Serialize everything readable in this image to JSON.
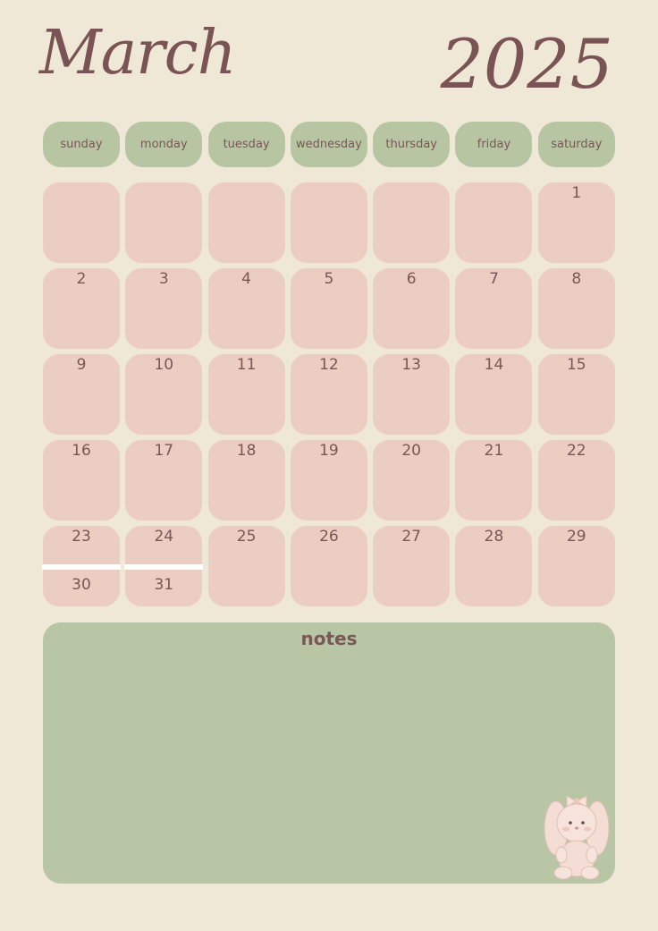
{
  "header": {
    "month": "March",
    "year": "2025"
  },
  "weekdays": [
    "sunday",
    "monday",
    "tuesday",
    "wednesday",
    "thursday",
    "friday",
    "saturday"
  ],
  "days": [
    [
      "",
      "",
      "",
      "",
      "",
      "",
      "1"
    ],
    [
      "2",
      "3",
      "4",
      "5",
      "6",
      "7",
      "8"
    ],
    [
      "9",
      "10",
      "11",
      "12",
      "13",
      "14",
      "15"
    ],
    [
      "16",
      "17",
      "18",
      "19",
      "20",
      "21",
      "22"
    ],
    [
      "23",
      "24",
      "25",
      "26",
      "27",
      "28",
      "29"
    ]
  ],
  "overflow_days": {
    "sunday": "30",
    "monday": "31"
  },
  "notes": {
    "title": "notes"
  },
  "colors": {
    "background": "#f0e8d6",
    "weekday_fill": "#b7c5a3",
    "day_fill": "#ebcdc1",
    "notes_fill": "#b9c6a6",
    "text": "#7a5656"
  },
  "decoration": {
    "icon": "bunny-plush-icon"
  }
}
